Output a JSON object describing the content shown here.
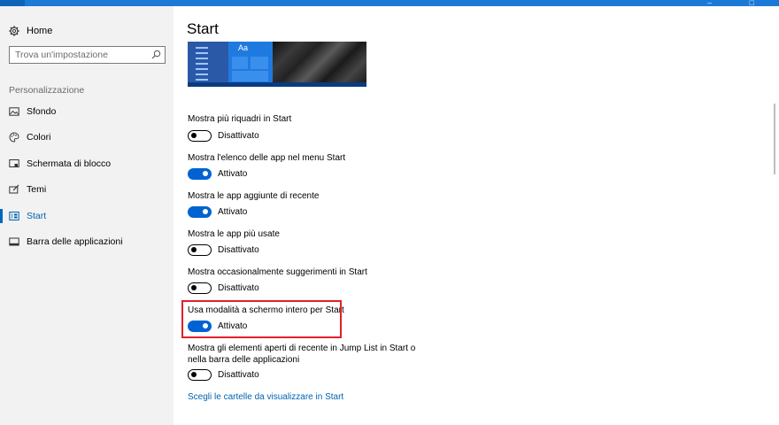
{
  "window": {
    "accent_color": "#1c7ad6",
    "controls_text": "–   □"
  },
  "sidebar": {
    "home_label": "Home",
    "search": {
      "placeholder": "Trova un'impostazione"
    },
    "section_label": "Personalizzazione",
    "items": [
      {
        "label": "Sfondo",
        "icon": "picture-icon",
        "active": false
      },
      {
        "label": "Colori",
        "icon": "palette-icon",
        "active": false
      },
      {
        "label": "Schermata di blocco",
        "icon": "lock-screen-icon",
        "active": false
      },
      {
        "label": "Temi",
        "icon": "brush-icon",
        "active": false
      },
      {
        "label": "Start",
        "icon": "start-menu-icon",
        "active": true
      },
      {
        "label": "Barra delle applicazioni",
        "icon": "taskbar-icon",
        "active": false
      }
    ]
  },
  "main": {
    "title": "Start",
    "preview": {
      "tile_label": "Aa"
    },
    "options": [
      {
        "label": "Mostra più riquadri in Start",
        "state": "Disattivato",
        "on": false
      },
      {
        "label": "Mostra l'elenco delle app nel menu Start",
        "state": "Attivato",
        "on": true
      },
      {
        "label": "Mostra le app aggiunte di recente",
        "state": "Attivato",
        "on": true
      },
      {
        "label": "Mostra le app più usate",
        "state": "Disattivato",
        "on": false
      },
      {
        "label": "Mostra occasionalmente suggerimenti in Start",
        "state": "Disattivato",
        "on": false
      },
      {
        "label": "Usa modalità a schermo intero per Start",
        "state": "Attivato",
        "on": true,
        "highlighted": true
      },
      {
        "label": "Mostra gli elementi aperti di recente in Jump List in Start o nella barra delle applicazioni",
        "state": "Disattivato",
        "on": false
      }
    ],
    "link": "Scegli le cartelle da visualizzare in Start"
  },
  "colors": {
    "toggle_on": "#0063d1",
    "highlight_border": "#e0202a",
    "link": "#0063b1"
  }
}
